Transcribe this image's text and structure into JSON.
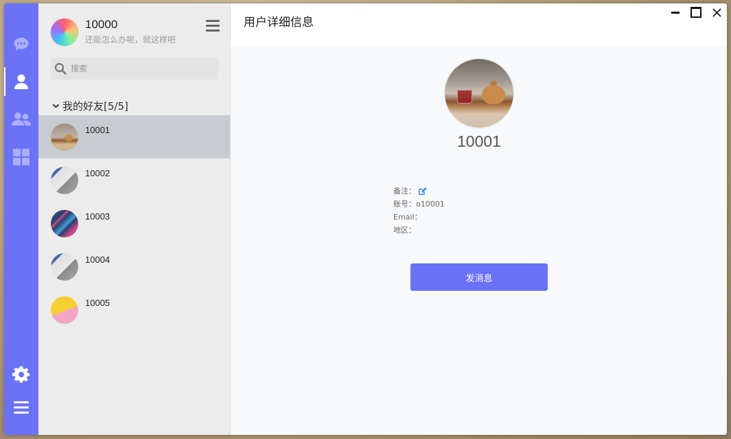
{
  "colors": {
    "accent": "#6a72f8",
    "rail": "#6a72f8",
    "panel": "#ececec",
    "selected": "#c8cbcf"
  },
  "rail": {
    "items": [
      {
        "icon": "chat-bubble-icon"
      },
      {
        "icon": "user-icon"
      },
      {
        "icon": "group-icon"
      },
      {
        "icon": "apps-grid-icon"
      }
    ],
    "bottom": [
      {
        "icon": "settings-gear-icon"
      },
      {
        "icon": "menu-icon"
      }
    ]
  },
  "me": {
    "name": "10000",
    "signature": "还能怎么办呢，就这样吧"
  },
  "search": {
    "placeholder": "搜索"
  },
  "group": {
    "title": "我的好友[5/5]"
  },
  "friends": [
    {
      "name": "10001",
      "avatar": "tea",
      "selected": true
    },
    {
      "name": "10002",
      "avatar": "desk"
    },
    {
      "name": "10003",
      "avatar": "neon"
    },
    {
      "name": "10004",
      "avatar": "desk"
    },
    {
      "name": "10005",
      "avatar": "yellow"
    }
  ],
  "main": {
    "title": "用户详细信息",
    "user_name": "10001",
    "info": {
      "remark_label": "备注：",
      "account_label": "账号：",
      "account_value": "o10001",
      "email_label": "Email：",
      "region_label": "地区："
    },
    "send_button": "发消息"
  }
}
